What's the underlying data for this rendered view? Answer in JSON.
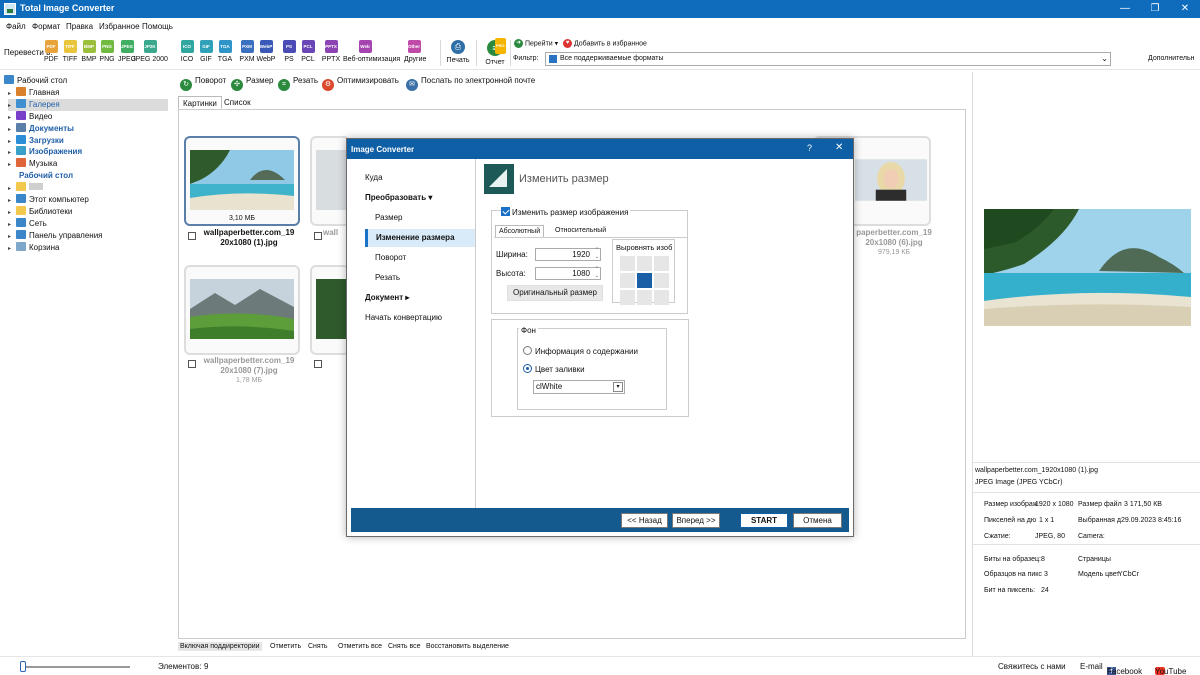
{
  "app": {
    "title": "Total Image Converter",
    "window_buttons": [
      "—",
      "❐",
      "✕"
    ]
  },
  "menu": [
    "Файл",
    "Формат",
    "Правка",
    "Избранное",
    "Помощь"
  ],
  "toolbar": {
    "convert_label": "Перевести в:",
    "formats": [
      {
        "label": "PDF",
        "color": "#e8a33a"
      },
      {
        "label": "TIFF",
        "color": "#e8c53a"
      },
      {
        "label": "BMP",
        "color": "#9bbf3a"
      },
      {
        "label": "PNG",
        "color": "#6fba3f"
      },
      {
        "label": "JPEG",
        "color": "#3fae63"
      },
      {
        "label": "JPEG 2000",
        "icon_text": "JP2K",
        "color": "#39a88d"
      },
      {
        "label": "ICO",
        "color": "#2fa7a0"
      },
      {
        "label": "GIF",
        "color": "#30a1b8"
      },
      {
        "label": "TGA",
        "color": "#2f95c9"
      },
      {
        "label": "PXM",
        "color": "#3b6fbf"
      },
      {
        "label": "WebP",
        "color": "#3a58b8"
      },
      {
        "label": "PS",
        "color": "#4a4bb5"
      },
      {
        "label": "PCL",
        "color": "#6a45b5"
      },
      {
        "label": "PPTX",
        "color": "#8c44b3"
      },
      {
        "label": "Веб-оптимизация",
        "icon_text": "Web",
        "color": "#a543b0"
      },
      {
        "label": "Другие",
        "icon_text": "Other",
        "color": "#c04aa8"
      }
    ],
    "print_label": "Печать",
    "report_label": "Отчет",
    "report_badge": "PRO",
    "goto_label": "Перейти",
    "fav_label": "Добавить в избранное",
    "filter_label": "Фильтр:",
    "filter_value": "Все поддерживаемые форматы",
    "more_label": "Дополнительн"
  },
  "tree": [
    {
      "label": "Рабочий стол",
      "icon": "desktop-icon",
      "color": "#3a86c8",
      "style": "normal"
    },
    {
      "label": "Главная",
      "icon": "home-icon",
      "color": "#d9822b",
      "style": "normal"
    },
    {
      "label": "Галерея",
      "icon": "gallery-icon",
      "color": "#3f8fd1",
      "style": "selected"
    },
    {
      "label": "Видео",
      "icon": "video-icon",
      "color": "#7a3fc9",
      "style": "normal"
    },
    {
      "label": "Документы",
      "icon": "documents-icon",
      "color": "#5a7fa8",
      "style": "blue"
    },
    {
      "label": "Загрузки",
      "icon": "downloads-icon",
      "color": "#2b8ed6",
      "style": "blue"
    },
    {
      "label": "Изображения",
      "icon": "images-icon",
      "color": "#3aa0c9",
      "style": "blue"
    },
    {
      "label": "Музыка",
      "icon": "music-icon",
      "color": "#e0663a",
      "style": "normal"
    },
    {
      "label": "Рабочий стол",
      "icon": "",
      "color": "",
      "style": "blue"
    },
    {
      "label": "",
      "icon": "folder-icon",
      "color": "#f2c94c",
      "style": "normal"
    },
    {
      "label": "Этот компьютер",
      "icon": "computer-icon",
      "color": "#3a86c8",
      "style": "normal"
    },
    {
      "label": "Библиотеки",
      "icon": "libraries-icon",
      "color": "#f2c94c",
      "style": "normal"
    },
    {
      "label": "Сеть",
      "icon": "network-icon",
      "color": "#3a86c8",
      "style": "normal"
    },
    {
      "label": "Панель управления",
      "icon": "control-panel-icon",
      "color": "#3a86c8",
      "style": "normal"
    },
    {
      "label": "Корзина",
      "icon": "recycle-bin-icon",
      "color": "#7fa7c9",
      "style": "normal"
    }
  ],
  "image_toolbar": [
    {
      "label": "Поворот",
      "color": "#2b8a3e",
      "glyph": "↻"
    },
    {
      "label": "Размер",
      "color": "#2b8a3e",
      "glyph": "✣"
    },
    {
      "label": "Резать",
      "color": "#2b8a3e",
      "glyph": "⌗"
    },
    {
      "label": "Оптимизировать",
      "color": "#d9482b",
      "glyph": "⚙"
    },
    {
      "label": "Послать по электронной почте",
      "color": "#3a6fa8",
      "glyph": "✉"
    }
  ],
  "tabs": [
    "Картинки",
    "Список"
  ],
  "gallery": {
    "items": [
      {
        "name": "wallpaperbetter.com_1920x1080 (1).jpg",
        "caption_lines": [
          "wallpaperbetter.com_19",
          "20x1080 (1).jpg"
        ],
        "size": "3,10 МБ",
        "selected": true
      },
      {
        "name": "wallpaperbetter.com_1920x1080 (6).jpg",
        "caption_lines": [
          "paperbetter.com_19",
          "20x1080 (6).jpg"
        ],
        "size": "979,19 КБ",
        "selected": false
      },
      {
        "name": "wallpaperbetter.com_1920x1080 (7).jpg",
        "caption_lines": [
          "wallpaperbetter.com_19",
          "20x1080 (7).jpg"
        ],
        "size": "1,78 МБ",
        "selected": false
      }
    ],
    "partial_caption": "wall"
  },
  "selection_bar": [
    "Включая поддиректории",
    "Отметить",
    "Снять",
    "Отметить все",
    "Снять все",
    "Восстановить выделение"
  ],
  "status": {
    "elements_label": "Элементов:",
    "elements_count": "9",
    "contact": "Свяжитесь с нами",
    "email": "E-mail",
    "facebook": "Facebook",
    "youtube": "YouTube"
  },
  "info": {
    "filename": "wallpaperbetter.com_1920x1080 (1).jpg",
    "type": "JPEG Image (JPEG YCbCr)",
    "size_label": "Размер изображ",
    "size_value": "1920 x 1080",
    "filesize_label": "Размер файл",
    "filesize_value": "3 171,50 КВ",
    "dpi_label": "Пикселей на дю",
    "dpi_value": "1 x 1",
    "selected_label": "Выбранная д",
    "selected_value": "29.09.2023 8:45:16",
    "compression_label": "Сжатие:",
    "compression_value": "JPEG, 80",
    "camera_label": "Camera:",
    "bits_label": "Биты на образец:",
    "bits_value": "8",
    "pages_label": "Страницы",
    "samples_label": "Образцов на пикс",
    "samples_value": "3",
    "model_label": "Модель цвет",
    "model_value": "YCbCr",
    "bpp_label": "Бит на пиксель:",
    "bpp_value": "24"
  },
  "dialog": {
    "title": "Image Converter",
    "help": "?",
    "close": "✕",
    "nav": [
      {
        "label": "Куда",
        "kind": "top"
      },
      {
        "label": "Преобразовать ▾",
        "kind": "bold"
      },
      {
        "label": "Размер",
        "kind": "sub"
      },
      {
        "label": "Изменение размера",
        "kind": "active"
      },
      {
        "label": "Поворот",
        "kind": "sub"
      },
      {
        "label": "Резать",
        "kind": "sub"
      },
      {
        "label": "Документ ▸",
        "kind": "bold"
      },
      {
        "label": "Начать конвертацию",
        "kind": "top"
      }
    ],
    "heading": "Изменить размер",
    "resize_checkbox": "Изменить размер изображения",
    "tab_absolute": "Абсолютный",
    "tab_relative": "Относительный",
    "width_label": "Ширина:",
    "width_value": "1920",
    "height_label": "Высота:",
    "height_value": "1080",
    "original_size": "Оригинальный размер",
    "align_label": "Выровнять изоб",
    "align_selected": "center",
    "background_label": "Фон",
    "radio_info": "Информация о содержании",
    "radio_fill": "Цвет заливки",
    "fill_color": "clWhite",
    "back": "<< Назад",
    "next": "Вперед >>",
    "start": "START",
    "cancel": "Отмена"
  }
}
